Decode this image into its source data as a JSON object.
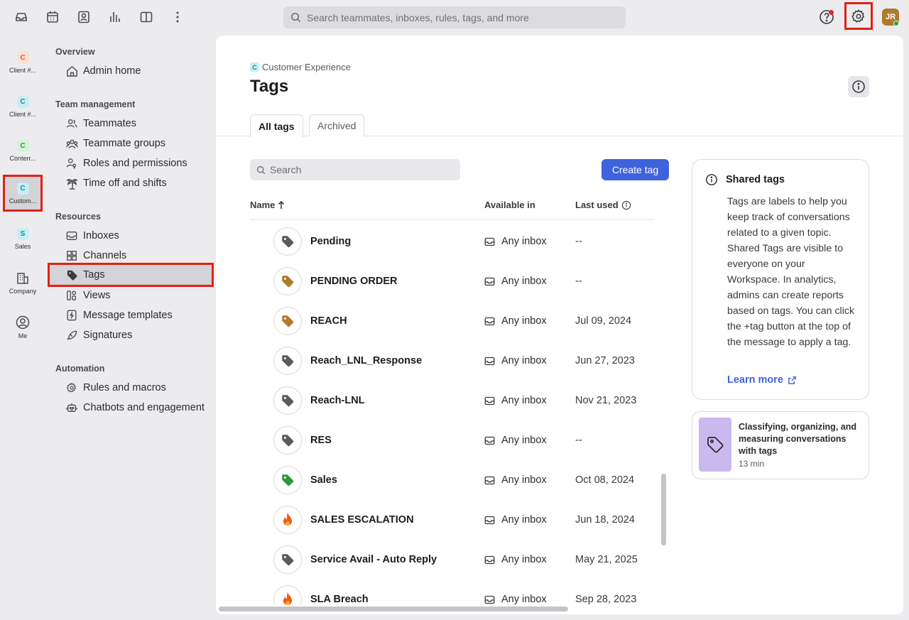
{
  "topbar": {
    "search_placeholder": "Search teammates, inboxes, rules, tags, and more",
    "avatar_initials": "JR",
    "icons": [
      "inbox-icon",
      "calendar-icon",
      "contacts-icon",
      "analytics-icon",
      "book-icon",
      "more-icon"
    ]
  },
  "rail": {
    "items": [
      {
        "badge": "C",
        "label": "Client #...",
        "badge_bg": "#fde0d2",
        "badge_fg": "#d9602a"
      },
      {
        "badge": "C",
        "label": "Client #...",
        "badge_bg": "#c8eef5",
        "badge_fg": "#1a8aa0"
      },
      {
        "badge": "C",
        "label": "Conterr...",
        "badge_bg": "#d4f2d8",
        "badge_fg": "#2a9a3e"
      },
      {
        "badge": "C",
        "label": "Custom...",
        "badge_bg": "#c8eef5",
        "badge_fg": "#1a8aa0"
      },
      {
        "badge": "S",
        "label": "Sales",
        "badge_bg": "#c8eef5",
        "badge_fg": "#1a8aa0"
      }
    ],
    "company_label": "Company",
    "me_label": "Me"
  },
  "nav": {
    "overview": "Overview",
    "admin_home": "Admin home",
    "team_management": "Team management",
    "teammates": "Teammates",
    "teammate_groups": "Teammate groups",
    "roles": "Roles and permissions",
    "time_off": "Time off and shifts",
    "resources": "Resources",
    "inboxes": "Inboxes",
    "channels": "Channels",
    "tags": "Tags",
    "views": "Views",
    "message_templates": "Message templates",
    "signatures": "Signatures",
    "automation": "Automation",
    "rules": "Rules and macros",
    "chatbots": "Chatbots and engagement"
  },
  "main": {
    "breadcrumb_badge": "C",
    "breadcrumb": "Customer Experience",
    "title": "Tags",
    "tabs": [
      {
        "label": "All tags"
      },
      {
        "label": "Archived"
      }
    ],
    "search_placeholder": "Search",
    "create_label": "Create tag",
    "columns": {
      "name": "Name",
      "available": "Available in",
      "last_used": "Last used"
    },
    "rows": [
      {
        "name": "Pending",
        "available": "Any inbox",
        "last_used": "--",
        "icon": "tag-icon",
        "color": "#5a5a62"
      },
      {
        "name": "PENDING ORDER",
        "available": "Any inbox",
        "last_used": "--",
        "icon": "tag-icon",
        "color": "#b07a2c"
      },
      {
        "name": "REACH",
        "available": "Any inbox",
        "last_used": "Jul 09, 2024",
        "icon": "tag-icon",
        "color": "#b07a2c"
      },
      {
        "name": "Reach_LNL_Response",
        "available": "Any inbox",
        "last_used": "Jun 27, 2023",
        "icon": "tag-icon",
        "color": "#5a5a62"
      },
      {
        "name": "Reach-LNL",
        "available": "Any inbox",
        "last_used": "Nov 21, 2023",
        "icon": "tag-icon",
        "color": "#5a5a62"
      },
      {
        "name": "RES",
        "available": "Any inbox",
        "last_used": "--",
        "icon": "tag-icon",
        "color": "#5a5a62"
      },
      {
        "name": "Sales",
        "available": "Any inbox",
        "last_used": "Oct 08, 2024",
        "icon": "tag-icon",
        "color": "#2a9a3e"
      },
      {
        "name": "SALES ESCALATION",
        "available": "Any inbox",
        "last_used": "Jun 18, 2024",
        "icon": "fire-icon",
        "color": "#e8501a"
      },
      {
        "name": "Service Avail - Auto Reply",
        "available": "Any inbox",
        "last_used": "May 21, 2025",
        "icon": "tag-icon",
        "color": "#5a5a62"
      },
      {
        "name": "SLA Breach",
        "available": "Any inbox",
        "last_used": "Sep 28, 2023",
        "icon": "fire-icon",
        "color": "#e8501a"
      }
    ]
  },
  "shared": {
    "title": "Shared tags",
    "body": "Tags are labels to help you keep track of conversations related to a given topic. Shared Tags are visible to everyone on your Workspace. In analytics, admins can create reports based on tags. You can click the +tag button at the top of the message to apply a tag.",
    "learn_more": "Learn more"
  },
  "guide": {
    "title": "Classifying, organizing, and measuring conversations with tags",
    "duration": "13 min"
  }
}
